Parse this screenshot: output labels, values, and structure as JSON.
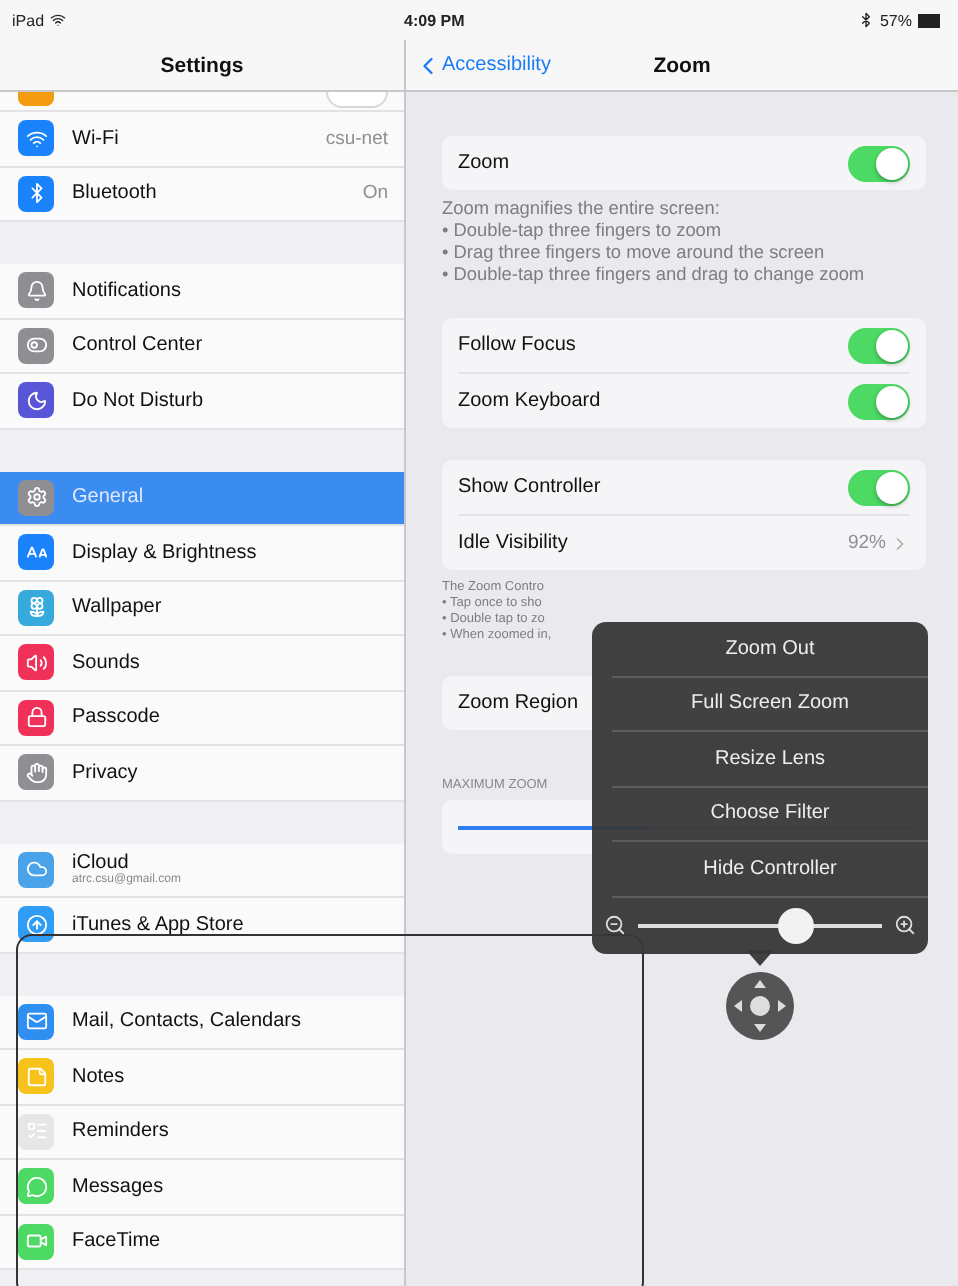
{
  "status_bar": {
    "carrier": "iPad",
    "time": "4:09 PM",
    "battery": "57%"
  },
  "sidebar": {
    "title": "Settings",
    "groups": [
      {
        "items": [
          {
            "kind": "toggle",
            "on": false,
            "selected": false,
            "color": "#f39c12"
          },
          {
            "kind": "value",
            "label": "Wi-Fi",
            "value": "csu-net",
            "selected": false,
            "color": "#1a82fb"
          },
          {
            "kind": "value",
            "label": "Bluetooth",
            "value": "On",
            "selected": false,
            "color": "#1a82fb"
          }
        ]
      },
      {
        "items": [
          {
            "kind": "plain",
            "label": "Notifications",
            "selected": false,
            "color": "#8e8e93"
          },
          {
            "kind": "plain",
            "label": "Control Center",
            "selected": false,
            "color": "#8e8e93"
          },
          {
            "kind": "plain",
            "label": "Do Not Disturb",
            "selected": false,
            "color": "#5856d6"
          }
        ]
      },
      {
        "items": [
          {
            "kind": "plain",
            "label": "General",
            "selected": true,
            "color": "#8e8e93"
          },
          {
            "kind": "plain",
            "label": "Display & Brightness",
            "selected": false,
            "color": "#1a82fb"
          },
          {
            "kind": "plain",
            "label": "Wallpaper",
            "selected": false,
            "color": "#36aadc"
          },
          {
            "kind": "plain",
            "label": "Sounds",
            "selected": false,
            "color": "#f0325a"
          },
          {
            "kind": "plain",
            "label": "Passcode",
            "selected": false,
            "color": "#f0325a"
          },
          {
            "kind": "plain",
            "label": "Privacy",
            "selected": false,
            "color": "#8e8e93"
          }
        ]
      },
      {
        "items": [
          {
            "kind": "subtitle",
            "label": "iCloud",
            "subtitle": "atrc.csu@gmail.com",
            "selected": false,
            "color": "#4aa3e8"
          },
          {
            "kind": "plain",
            "label": "iTunes & App Store",
            "selected": false,
            "color": "#2f9cf5"
          }
        ]
      },
      {
        "items": [
          {
            "kind": "plain",
            "label": "Mail, Contacts, Calendars",
            "selected": false,
            "color": "#2f8ff0"
          },
          {
            "kind": "plain",
            "label": "Notes",
            "selected": false,
            "color": "#f7c21a"
          },
          {
            "kind": "plain",
            "label": "Reminders",
            "selected": false,
            "color": "#e6e6e6"
          },
          {
            "kind": "plain",
            "label": "Messages",
            "selected": false,
            "color": "#4cd964"
          },
          {
            "kind": "plain",
            "label": "FaceTime",
            "selected": false,
            "color": "#4cd964"
          }
        ]
      }
    ]
  },
  "detail": {
    "back": "Accessibility",
    "title": "Zoom",
    "sections": [
      {
        "rows": [
          {
            "kind": "toggle",
            "label": "Zoom",
            "on": true
          }
        ],
        "footer": [
          "Zoom magnifies the entire screen:",
          "• Double-tap three fingers to zoom",
          "• Drag three fingers to move around the screen",
          "• Double-tap three fingers and drag to change zoom"
        ]
      },
      {
        "rows": [
          {
            "kind": "toggle",
            "label": "Follow Focus",
            "on": true
          },
          {
            "kind": "toggle",
            "label": "Zoom Keyboard",
            "on": true
          }
        ]
      },
      {
        "rows": [
          {
            "kind": "toggle",
            "label": "Show Controller",
            "on": true
          },
          {
            "kind": "value",
            "label": "Idle Visibility",
            "value": "92%"
          }
        ],
        "small_footer": [
          "The Zoom Contro",
          "• Tap once to sho",
          "• Double tap to zo",
          "• When zoomed in,"
        ]
      },
      {
        "rows": [
          {
            "kind": "nav",
            "label": "Zoom Region"
          }
        ]
      },
      {
        "header": "MAXIMUM ZOOM",
        "rows": [
          {
            "kind": "slider",
            "level": 0.42
          }
        ]
      }
    ]
  },
  "controller_menu": {
    "items": [
      "Zoom Out",
      "Full Screen Zoom",
      "Resize Lens",
      "Choose Filter",
      "Hide Controller"
    ],
    "zoom_slider": {
      "level": 0.65
    }
  }
}
